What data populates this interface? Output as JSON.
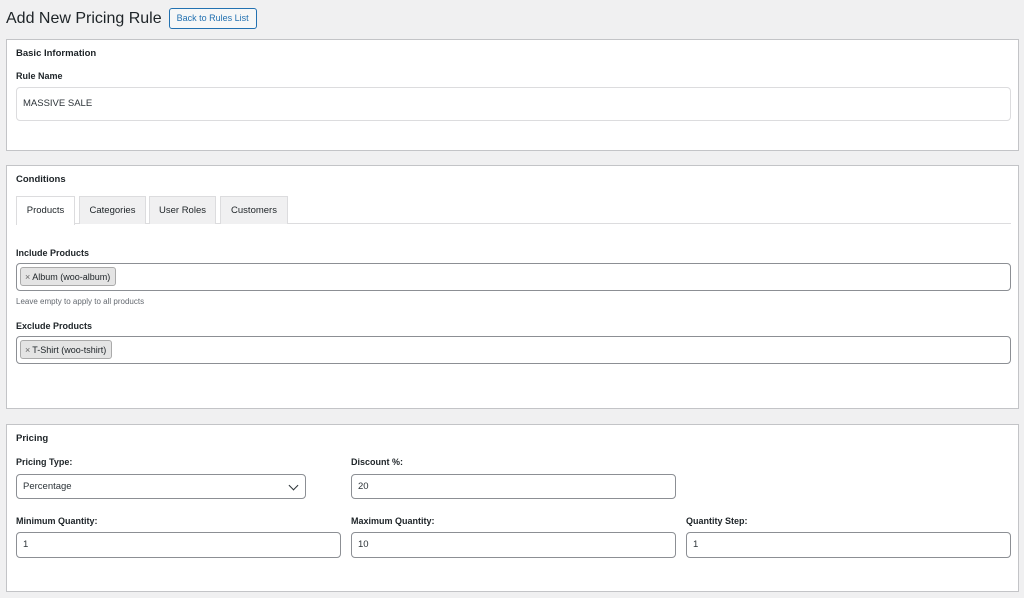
{
  "header": {
    "title": "Add New Pricing Rule",
    "back_label": "Back to Rules List"
  },
  "basic": {
    "heading": "Basic Information",
    "rule_name_label": "Rule Name",
    "rule_name_value": "MASSIVE SALE"
  },
  "conditions": {
    "heading": "Conditions",
    "tabs": [
      {
        "label": "Products",
        "active": true
      },
      {
        "label": "Categories",
        "active": false
      },
      {
        "label": "User Roles",
        "active": false
      },
      {
        "label": "Customers",
        "active": false
      }
    ],
    "include_label": "Include Products",
    "include_tags": [
      {
        "remove": "×",
        "label": "Album (woo-album)"
      }
    ],
    "include_help": "Leave empty to apply to all products",
    "exclude_label": "Exclude Products",
    "exclude_tags": [
      {
        "remove": "×",
        "label": "T-Shirt (woo-tshirt)"
      }
    ]
  },
  "pricing": {
    "heading": "Pricing",
    "type_label": "Pricing Type:",
    "type_value": "Percentage",
    "discount_label": "Discount %:",
    "discount_value": "20",
    "min_label": "Minimum Quantity:",
    "min_value": "1",
    "max_label": "Maximum Quantity:",
    "max_value": "10",
    "step_label": "Quantity Step:",
    "step_value": "1"
  },
  "colors": {
    "accent": "#2271b1",
    "background": "#f0f0f1",
    "border": "#c3c4c7"
  }
}
